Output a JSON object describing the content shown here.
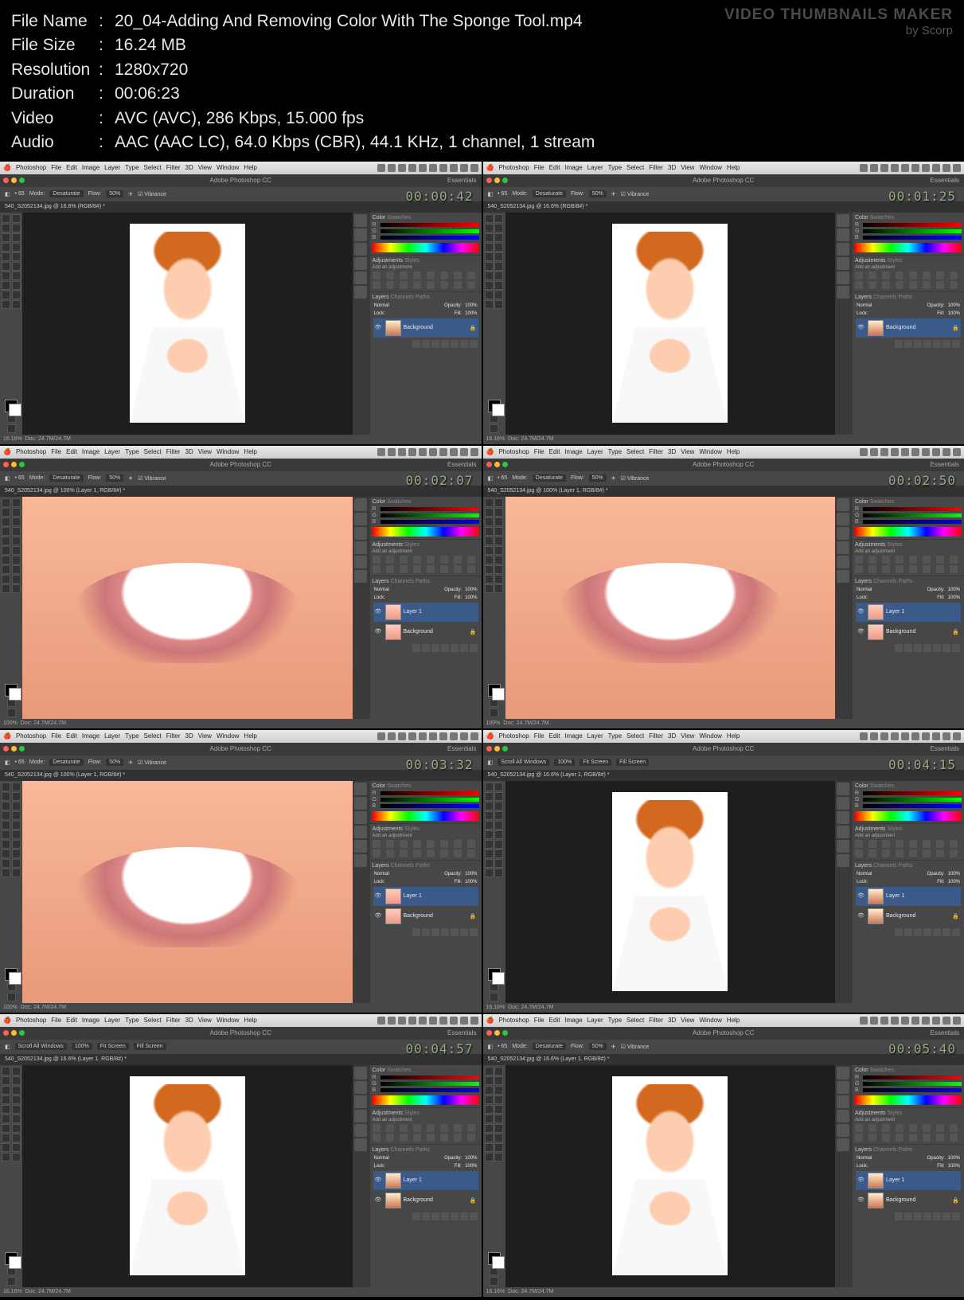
{
  "watermark": {
    "title": "VIDEO THUMBNAILS MAKER",
    "by": "by Scorp"
  },
  "meta": {
    "file_name_label": "File Name",
    "file_name": "20_04-Adding And Removing Color With The Sponge Tool.mp4",
    "file_size_label": "File Size",
    "file_size": "16.24 MB",
    "resolution_label": "Resolution",
    "resolution": "1280x720",
    "duration_label": "Duration",
    "duration": "00:06:23",
    "video_label": "Video",
    "video": "AVC (AVC), 286 Kbps, 15.000 fps",
    "audio_label": "Audio",
    "audio": "AAC (AAC LC), 64.0 Kbps (CBR), 44.1 KHz, 1 channel, 1 stream"
  },
  "menus": [
    "Photoshop",
    "File",
    "Edit",
    "Image",
    "Layer",
    "Type",
    "Select",
    "Filter",
    "3D",
    "View",
    "Window",
    "Help"
  ],
  "app_title": "Adobe Photoshop CC",
  "workspace": "Essentials",
  "option_labels": {
    "mode": "Mode:",
    "desaturate": "Desaturate",
    "flow": "Flow:",
    "vibrance": "Vibrance"
  },
  "panels": {
    "color": "Color",
    "swatches": "Swatches",
    "adjustments": "Adjustments",
    "styles": "Styles",
    "add_adjustment": "Add an adjustment",
    "layers": "Layers",
    "channels": "Channels",
    "paths": "Paths",
    "normal": "Normal",
    "opacity": "Opacity:",
    "lock": "Lock:",
    "fill": "Fill:",
    "background": "Background",
    "layer1": "Layer 1"
  },
  "thumbs": [
    {
      "time": "00:00:42",
      "tab": "540_S2052134.jpg @ 16.6% (RGB/8#) *",
      "zoom": "16.16%",
      "mode": "portrait",
      "layers": [
        "bg"
      ]
    },
    {
      "time": "00:01:25",
      "tab": "540_S2052134.jpg @ 16.6% (RGB/8#) *",
      "zoom": "16.16%",
      "mode": "portrait",
      "layers": [
        "bg"
      ]
    },
    {
      "time": "00:02:07",
      "tab": "540_S2052134.jpg @ 100% (Layer 1, RGB/8#) *",
      "zoom": "100%",
      "mode": "smile",
      "layers": [
        "layer1",
        "bg"
      ]
    },
    {
      "time": "00:02:50",
      "tab": "540_S2052134.jpg @ 100% (Layer 1, RGB/8#) *",
      "zoom": "100%",
      "mode": "smile",
      "layers": [
        "layer1",
        "bg"
      ]
    },
    {
      "time": "00:03:32",
      "tab": "540_S2052134.jpg @ 100% (Layer 1, RGB/8#) *",
      "zoom": "100%",
      "mode": "smile",
      "layers": [
        "layer1",
        "bg"
      ]
    },
    {
      "time": "00:04:15",
      "tab": "540_S2052134.jpg @ 16.6% (Layer 1, RGB/8#) *",
      "zoom": "16.16%",
      "mode": "portrait",
      "layers": [
        "layer1",
        "bg"
      ],
      "scroll": true
    },
    {
      "time": "00:04:57",
      "tab": "540_S2052134.jpg @ 16.6% (Layer 1, RGB/8#) *",
      "zoom": "16.16%",
      "mode": "portrait",
      "layers": [
        "layer1",
        "bg"
      ],
      "scroll": true
    },
    {
      "time": "00:05:40",
      "tab": "540_S2052134.jpg @ 16.6% (Layer 1, RGB/8#) *",
      "zoom": "16.16%",
      "mode": "portrait",
      "layers": [
        "layer1",
        "bg"
      ]
    }
  ],
  "status_doc": "Doc: 24.7M/24.7M"
}
